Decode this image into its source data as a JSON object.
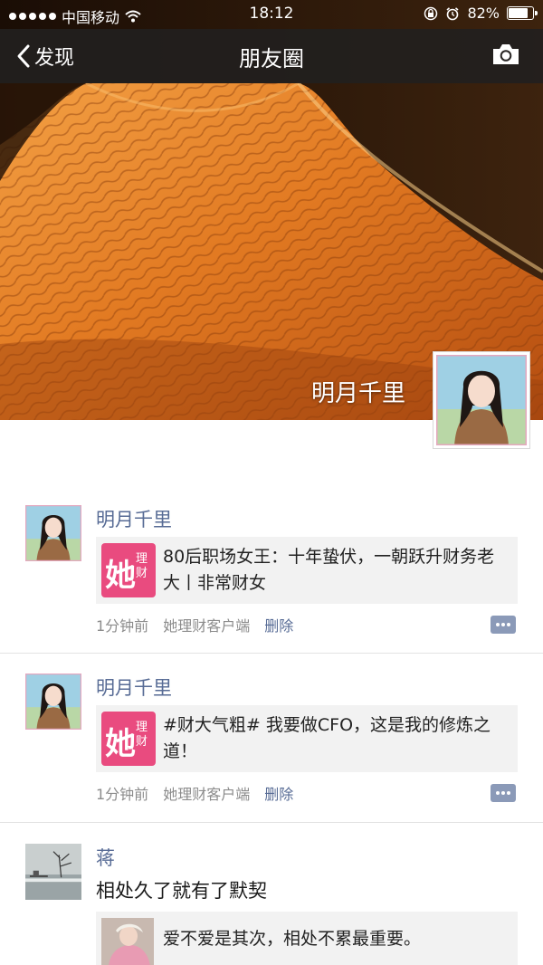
{
  "status_bar": {
    "carrier": "中国移动",
    "time": "18:12",
    "battery": "82%",
    "battery_level": 0.82
  },
  "nav": {
    "back_label": "发现",
    "title": "朋友圈"
  },
  "profile": {
    "name": "明月千里"
  },
  "posts": [
    {
      "author": "明月千里",
      "share": {
        "app_icon_text": "她",
        "app_icon_sub": "理财",
        "text": "80后职场女王：十年蛰伏，一朝跃升财务老大丨非常财女"
      },
      "time": "1分钟前",
      "source": "她理财客户端",
      "delete_label": "删除"
    },
    {
      "author": "明月千里",
      "share": {
        "app_icon_text": "她",
        "app_icon_sub": "理财",
        "text": "#财大气粗# 我要做CFO，这是我的修炼之道！"
      },
      "time": "1分钟前",
      "source": "她理财客户端",
      "delete_label": "删除"
    },
    {
      "author": "蒋",
      "text": "相处久了就有了默契",
      "share": {
        "text": "爱不爱是其次，相处不累最重要。"
      }
    }
  ],
  "colors": {
    "link": "#576b95",
    "app_pink": "#e94b7f"
  },
  "icons": [
    "signal-dots-icon",
    "wifi-icon",
    "lock-rotation-icon",
    "alarm-icon",
    "battery-icon",
    "back-chevron-icon",
    "camera-icon",
    "comment-more-icon"
  ]
}
